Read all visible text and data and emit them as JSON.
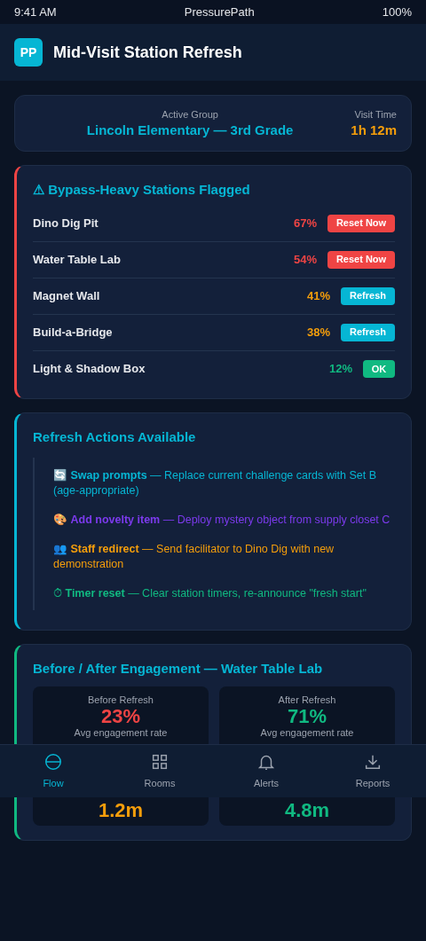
{
  "status_bar": {
    "time": "9:41 AM",
    "title": "PressurePath",
    "battery": "100%"
  },
  "header": {
    "logo": "PP",
    "title": "Mid-Visit Station Refresh"
  },
  "group_card": {
    "label": "Active Group",
    "group": "Lincoln Elementary — 3rd Grade",
    "time_label": "Visit Time",
    "time": "1h 12m"
  },
  "flagged": {
    "title": "⚠ Bypass-Heavy Stations Flagged",
    "stations": [
      {
        "name": "Dino Dig Pit",
        "percent": "67%",
        "action": "Reset Now",
        "kind": "reset"
      },
      {
        "name": "Water Table Lab",
        "percent": "54%",
        "action": "Reset Now",
        "kind": "reset"
      },
      {
        "name": "Magnet Wall",
        "percent": "41%",
        "action": "Refresh",
        "kind": "refresh"
      },
      {
        "name": "Build-a-Bridge",
        "percent": "38%",
        "action": "Refresh",
        "kind": "refresh"
      },
      {
        "name": "Light & Shadow Box",
        "percent": "12%",
        "action": "OK",
        "kind": "ok"
      }
    ]
  },
  "actions": {
    "title": "Refresh Actions Available",
    "items": [
      {
        "text": "🔄 **Swap prompts** — Replace current challenge cards with Set B (age-appropriate)",
        "color": "#06b6d4"
      },
      {
        "text": "🎨 **Add novelty item** — Deploy mystery object from supply closet C",
        "color": "#7c3aed"
      },
      {
        "text": "👥 **Staff redirect** — Send facilitator to Dino Dig with new demonstration",
        "color": "#f59e0b"
      },
      {
        "text": "⏱ **Timer reset** — Clear station timers, re-announce \"fresh start\"",
        "color": "#10b981"
      }
    ]
  },
  "comparison": {
    "title": "Before / After Engagement — Water Table Lab",
    "panels": [
      {
        "label": "Before Refresh",
        "caption": "Avg engagement rate",
        "values": [
          {
            "text": "23%",
            "color": "#ef4444"
          },
          {
            "text": "1.2m",
            "color": "#f59e0b"
          }
        ]
      },
      {
        "label": "After Refresh",
        "caption": "Avg engagement rate",
        "values": [
          {
            "text": "71%",
            "color": "#10b981"
          },
          {
            "text": "4.8m",
            "color": "#10b981"
          }
        ]
      }
    ]
  },
  "nav": [
    {
      "label": "Flow",
      "selected": true
    },
    {
      "label": "Rooms",
      "selected": false
    },
    {
      "label": "Alerts",
      "selected": false
    },
    {
      "label": "Reports",
      "selected": false
    }
  ]
}
